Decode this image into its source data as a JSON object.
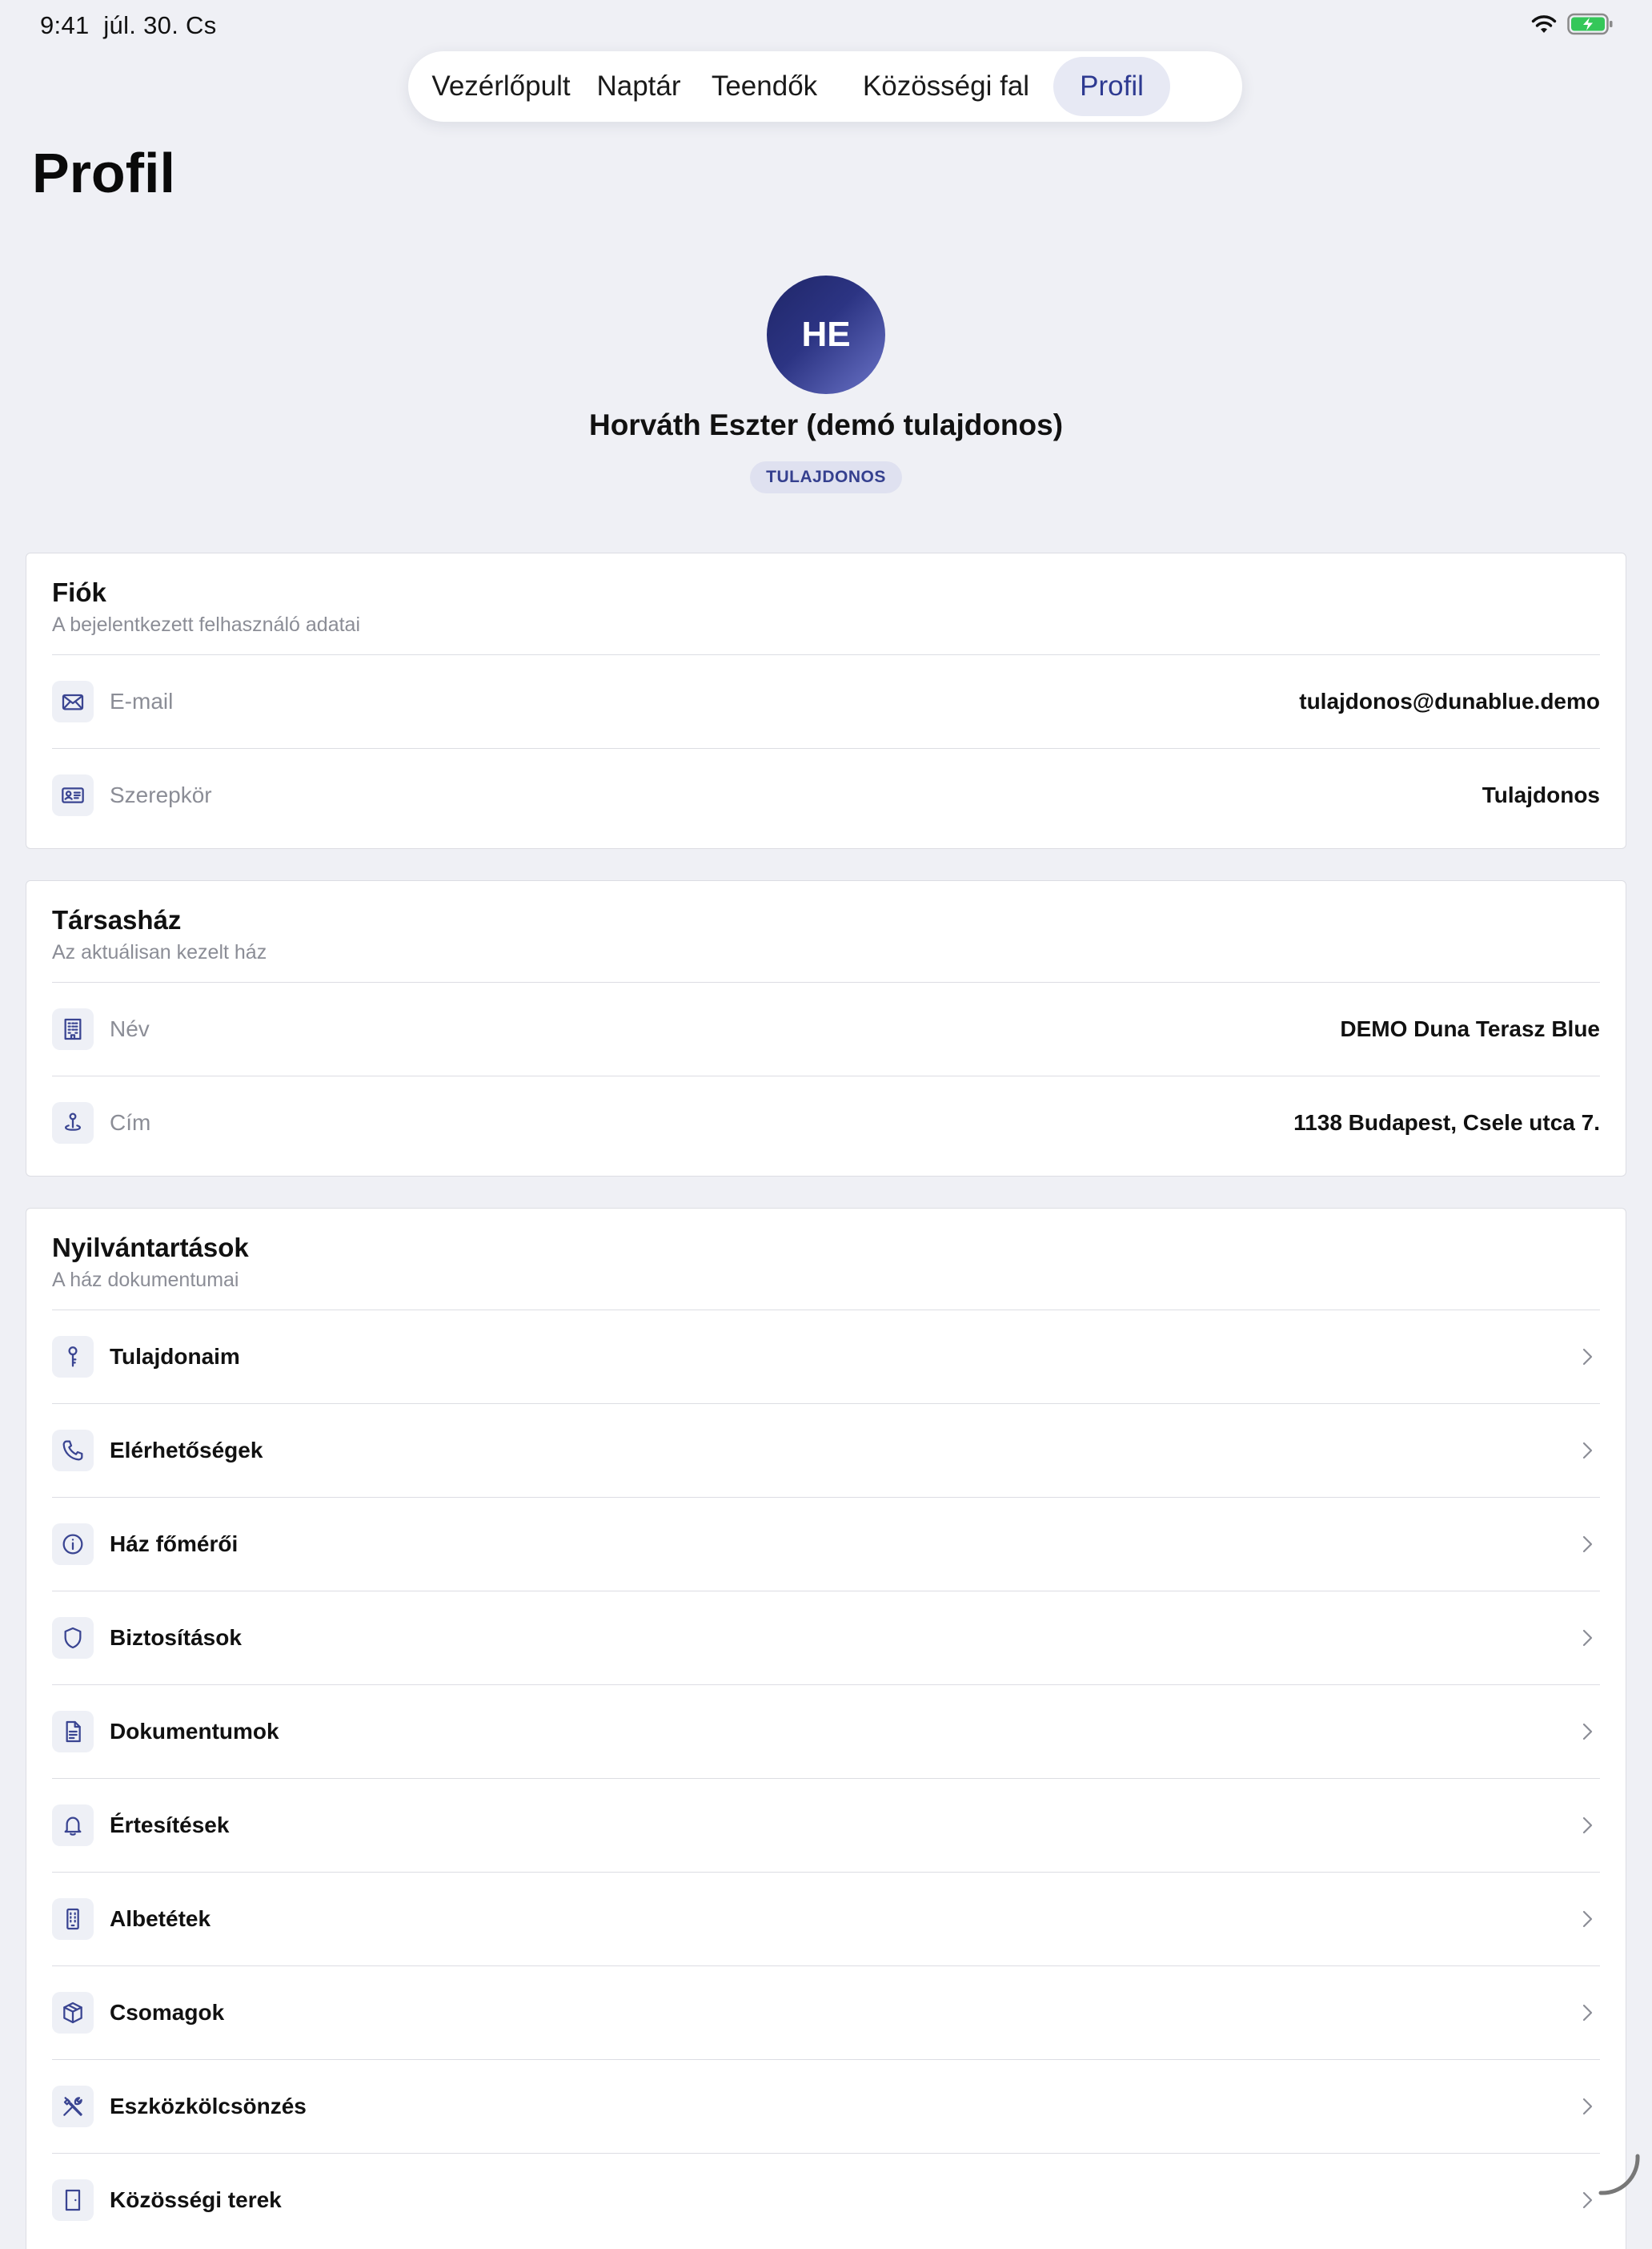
{
  "status_bar": {
    "time": "9:41",
    "date": "júl. 30. Cs",
    "wifi_icon": "wifi-icon",
    "battery_icon": "battery-charging-icon",
    "battery_color": "#34c759"
  },
  "tabs": [
    {
      "label": "Vezérlőpult",
      "active": false
    },
    {
      "label": "Naptár",
      "active": false
    },
    {
      "label": "Teendők",
      "active": false
    },
    {
      "label": "Közösségi fal",
      "active": false
    },
    {
      "label": "Profil",
      "active": true
    }
  ],
  "page": {
    "title": "Profil"
  },
  "profile": {
    "initials": "HE",
    "name": "Horváth Eszter (demó tulajdonos)",
    "role_badge": "TULAJDONOS"
  },
  "account_card": {
    "title": "Fiók",
    "subtitle": "A bejelentkezett felhasználó adatai",
    "rows": [
      {
        "icon": "envelope-icon",
        "label": "E-mail",
        "value": "tulajdonos@dunablue.demo"
      },
      {
        "icon": "id-card-icon",
        "label": "Szerepkör",
        "value": "Tulajdonos"
      }
    ]
  },
  "building_card": {
    "title": "Társasház",
    "subtitle": "Az aktuálisan kezelt ház",
    "rows": [
      {
        "icon": "building-icon",
        "label": "Név",
        "value": "DEMO Duna Terasz Blue"
      },
      {
        "icon": "map-pin-icon",
        "label": "Cím",
        "value": "1138 Budapest, Csele utca 7."
      }
    ]
  },
  "records_card": {
    "title": "Nyilvántartások",
    "subtitle": "A ház dokumentumai",
    "items": [
      {
        "icon": "key-icon",
        "label": "Tulajdonaim"
      },
      {
        "icon": "phone-icon",
        "label": "Elérhetőségek"
      },
      {
        "icon": "info-icon",
        "label": "Ház főmérői"
      },
      {
        "icon": "shield-icon",
        "label": "Biztosítások"
      },
      {
        "icon": "document-icon",
        "label": "Dokumentumok"
      },
      {
        "icon": "bell-icon",
        "label": "Értesítések"
      },
      {
        "icon": "apartment-icon",
        "label": "Albetétek"
      },
      {
        "icon": "package-icon",
        "label": "Csomagok"
      },
      {
        "icon": "tools-icon",
        "label": "Eszközkölcsönzés"
      },
      {
        "icon": "door-icon",
        "label": "Közösségi terek"
      }
    ]
  },
  "colors": {
    "accent": "#2e3a91",
    "background": "#eff0f5",
    "icon_color": "#3a4592"
  }
}
